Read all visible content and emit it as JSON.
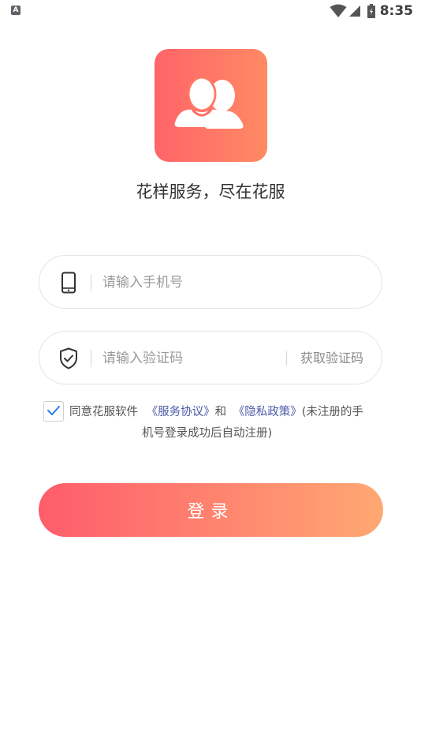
{
  "status_bar": {
    "notification_letter": "A",
    "time": "8:35",
    "icons": [
      "wifi-icon",
      "signal-icon",
      "battery-icon"
    ]
  },
  "app": {
    "logo_icon": "users-icon",
    "slogan": "花样服务，尽在花服",
    "colors": {
      "gradient_start": "#ff5c6b",
      "gradient_end": "#ffa872",
      "link": "#4a5aa8",
      "check": "#2a7de1"
    }
  },
  "form": {
    "phone": {
      "icon": "phone-icon",
      "placeholder": "请输入手机号",
      "value": ""
    },
    "code": {
      "icon": "shield-check-icon",
      "placeholder": "请输入验证码",
      "value": "",
      "get_code_label": "获取验证码"
    }
  },
  "agreement": {
    "checked": true,
    "prefix": "同意花服软件",
    "service_link": "《服务协议》",
    "and": "和",
    "privacy_link": "《隐私政策》",
    "suffix_line1": "(未注册的手",
    "suffix_line2": "机号登录成功后自动注册)"
  },
  "login_button": {
    "label": "登录"
  }
}
